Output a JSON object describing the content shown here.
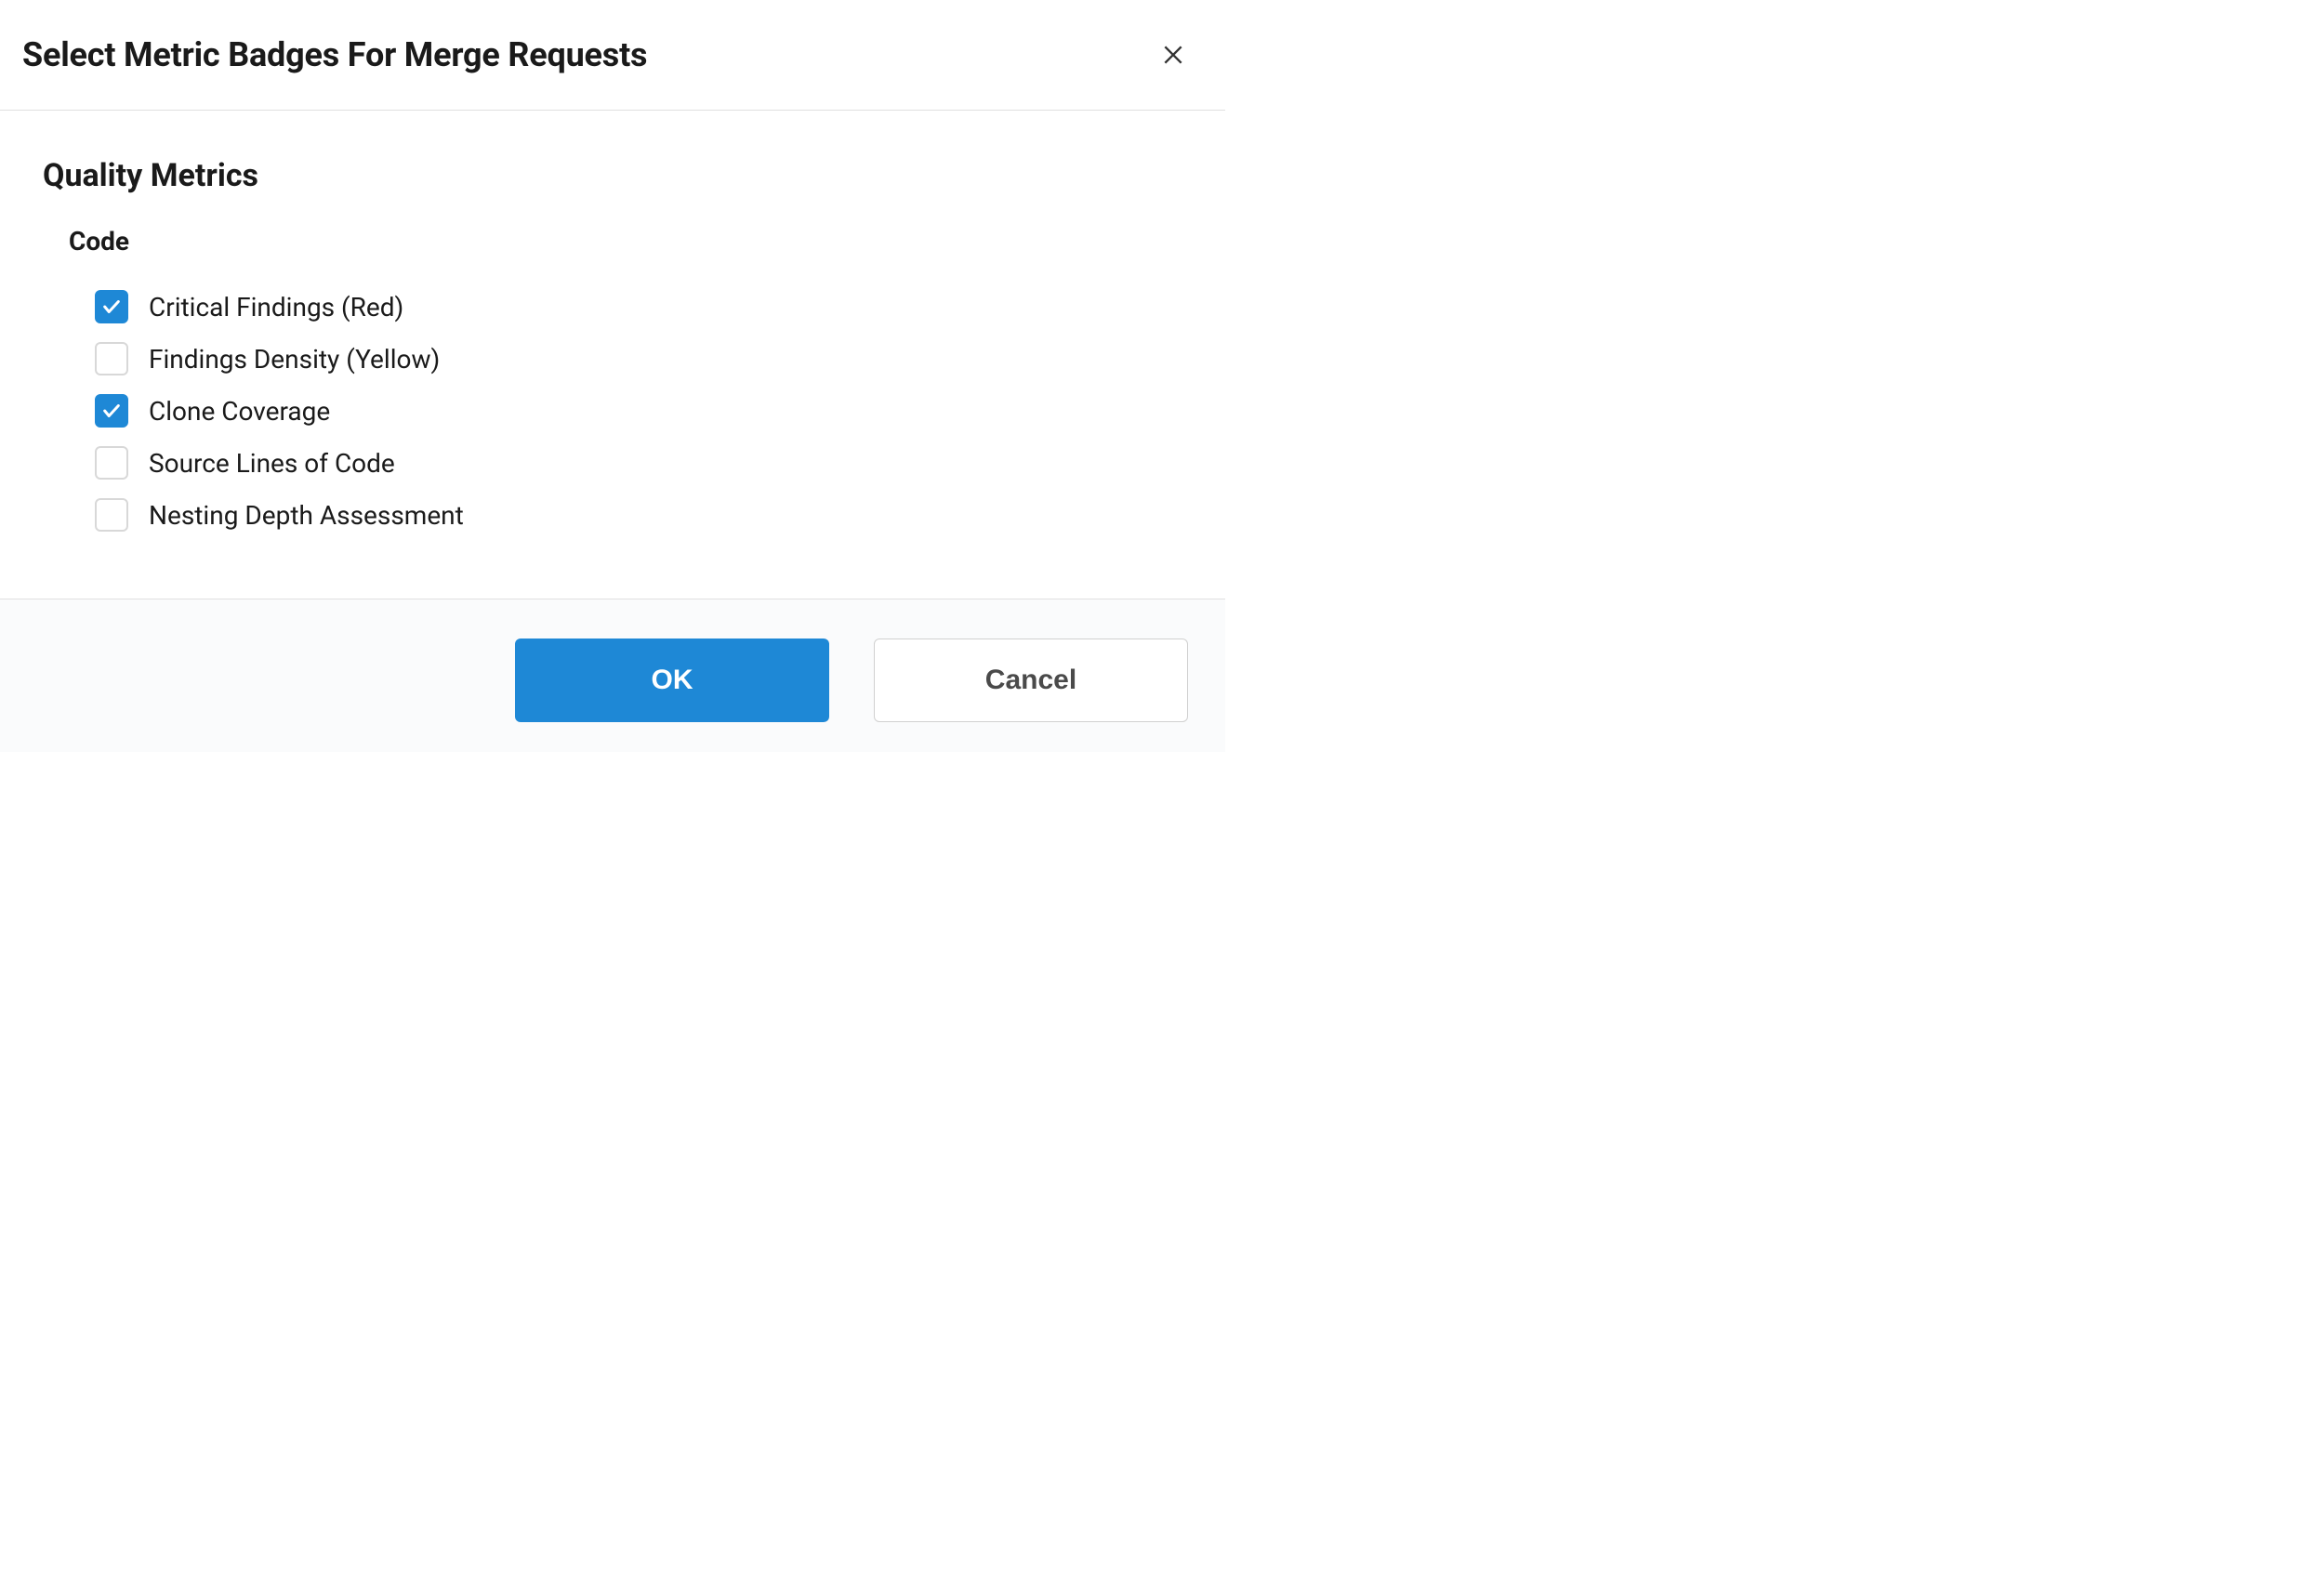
{
  "dialog": {
    "title": "Select Metric Badges For Merge Requests",
    "sectionTitle": "Quality Metrics",
    "subsection": "Code",
    "items": [
      {
        "label": "Critical Findings (Red)",
        "checked": true
      },
      {
        "label": "Findings Density (Yellow)",
        "checked": false
      },
      {
        "label": "Clone Coverage",
        "checked": true
      },
      {
        "label": "Source Lines of Code",
        "checked": false
      },
      {
        "label": "Nesting Depth Assessment",
        "checked": false
      }
    ]
  },
  "buttons": {
    "ok": "OK",
    "cancel": "Cancel"
  }
}
